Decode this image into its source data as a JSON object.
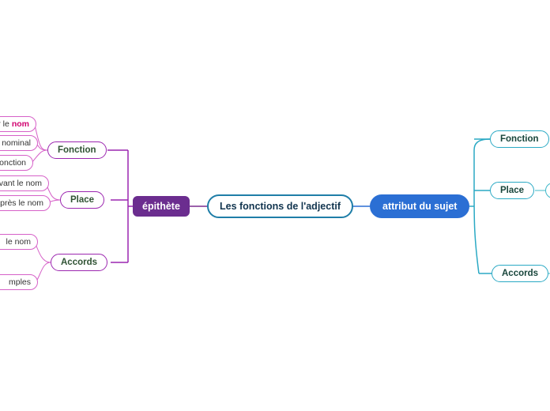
{
  "diagram": {
    "type": "mind-map",
    "title": "Les fonctions de l'adjectif",
    "center": {
      "label": "Les fonctions de l'adjectif",
      "color": "#1f7ea8"
    },
    "branches": [
      {
        "id": "epithete",
        "label": "épithète",
        "color": "#6b2d8f",
        "side": "left",
        "children": [
          {
            "id": "fonction-left",
            "label": "Fonction",
            "color": "#9c27b0",
            "leaves": [
              {
                "text": "sur le",
                "highlight": "nom"
              },
              {
                "text": "le nominal",
                "highlight": ""
              },
              {
                "text": "fonction",
                "highlight": ""
              }
            ]
          },
          {
            "id": "place-left",
            "label": "Place",
            "color": "#9c27b0",
            "leaves": [
              {
                "text": "avant le nom",
                "highlight": ""
              },
              {
                "text": "après le nom",
                "highlight": ""
              }
            ]
          },
          {
            "id": "accords-left",
            "label": "Accords",
            "color": "#9c27b0",
            "leaves": [
              {
                "text": "le nom",
                "highlight": ""
              },
              {
                "text": "mples",
                "highlight": ""
              }
            ]
          }
        ]
      },
      {
        "id": "attribut",
        "label": "attribut du sujet",
        "color": "#2b6fd4",
        "side": "right",
        "children": [
          {
            "id": "fonction-right",
            "label": "Fonction",
            "color": "#2aa9c4",
            "leaves": []
          },
          {
            "id": "place-right",
            "label": "Place",
            "color": "#2aa9c4",
            "leaves": [
              {
                "text": "",
                "highlight": ""
              }
            ]
          },
          {
            "id": "accords-right",
            "label": "Accords",
            "color": "#2aa9c4",
            "leaves": []
          }
        ]
      }
    ]
  }
}
